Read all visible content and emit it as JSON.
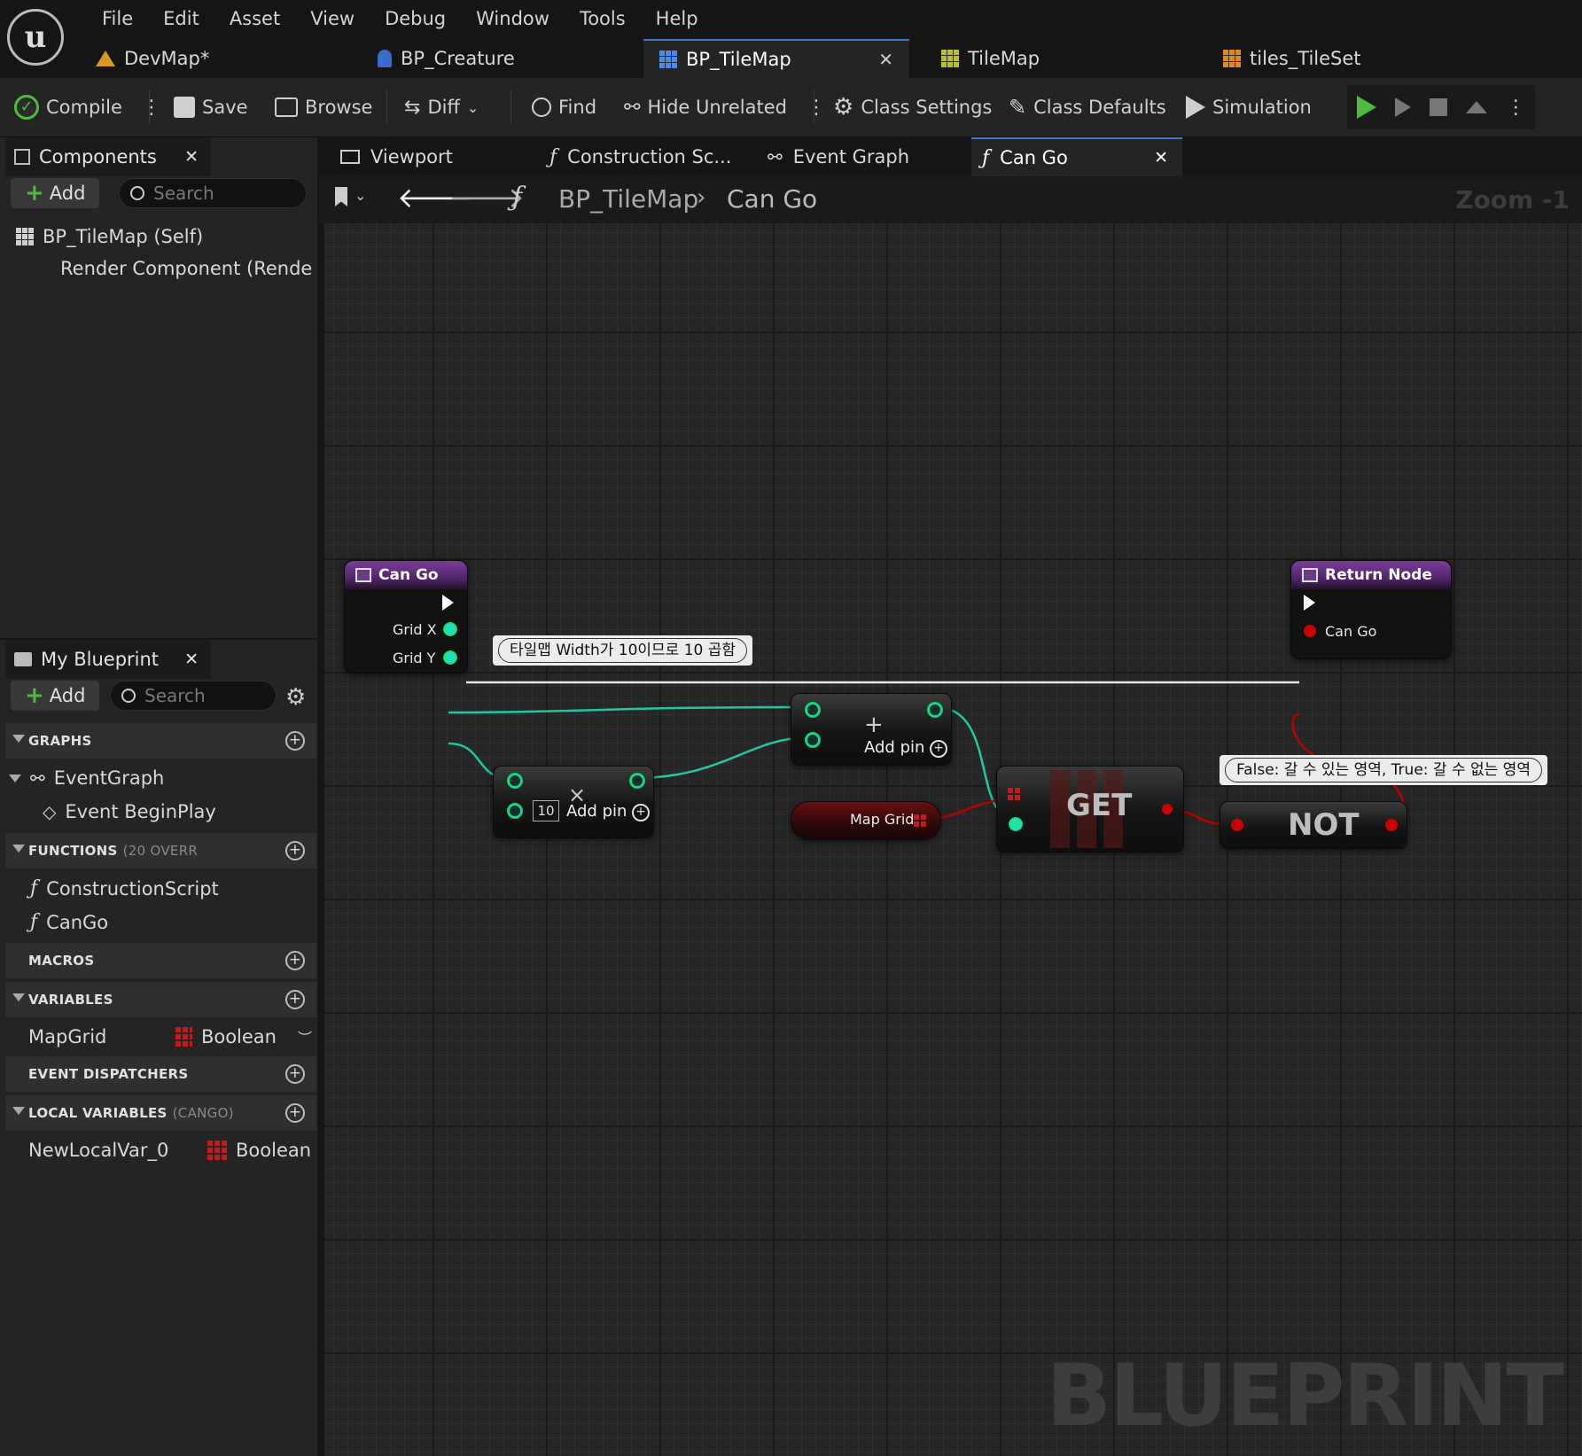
{
  "menu": [
    "File",
    "Edit",
    "Asset",
    "View",
    "Debug",
    "Window",
    "Tools",
    "Help"
  ],
  "asset_tabs": [
    {
      "label": "DevMap*",
      "icon": "map-icon"
    },
    {
      "label": "BP_Creature",
      "icon": "pawn-icon"
    },
    {
      "label": "BP_TileMap",
      "icon": "grid-icon",
      "active": true
    },
    {
      "label": "TileMap",
      "icon": "tilemap-icon"
    },
    {
      "label": "tiles_TileSet",
      "icon": "tileset-icon"
    }
  ],
  "toolbar": {
    "compile": "Compile",
    "save": "Save",
    "browse": "Browse",
    "diff": "Diff",
    "find": "Find",
    "hide_unrelated": "Hide Unrelated",
    "class_settings": "Class Settings",
    "class_defaults": "Class Defaults",
    "simulation": "Simulation"
  },
  "components": {
    "tab": "Components",
    "add": "Add",
    "search_placeholder": "Search",
    "items": [
      "BP_TileMap (Self)",
      "Render Component (RenderCo"
    ]
  },
  "my_blueprint": {
    "tab": "My Blueprint",
    "add": "Add",
    "search_placeholder": "Search",
    "graphs_header": "GRAPHS",
    "graphs": [
      "EventGraph",
      "Event BeginPlay"
    ],
    "functions_header": "FUNCTIONS",
    "functions_sub": "(20 OVERR",
    "functions": [
      "ConstructionScript",
      "CanGo"
    ],
    "macros_header": "MACROS",
    "variables_header": "VARIABLES",
    "variables": [
      {
        "name": "MapGrid",
        "type": "Boolean"
      }
    ],
    "dispatchers_header": "EVENT DISPATCHERS",
    "local_header": "LOCAL VARIABLES",
    "local_sub": "(CANGO)",
    "locals": [
      {
        "name": "NewLocalVar_0",
        "type": "Boolean"
      }
    ]
  },
  "doc_tabs": [
    "Viewport",
    "Construction Sc...",
    "Event Graph",
    "Can Go"
  ],
  "breadcrumb": {
    "root": "BP_TileMap",
    "current": "Can Go",
    "zoom": "Zoom -1"
  },
  "graph": {
    "entry_node": {
      "title": "Can Go",
      "pins": [
        "Grid X",
        "Grid Y"
      ]
    },
    "multiply_node": {
      "const": "10",
      "add_pin": "Add pin",
      "op": "×"
    },
    "add_node": {
      "add_pin": "Add pin",
      "op": "+"
    },
    "comment_multiply": "타일맵 Width가 10이므로 10 곱함",
    "map_grid_var": "Map Grid",
    "get_node": "GET",
    "not_node": "NOT",
    "comment_not": "False: 갈 수 있는 영역, True: 갈 수 없는 영역",
    "return_node": {
      "title": "Return Node",
      "pin": "Can Go"
    },
    "watermark": "BLUEPRINT"
  },
  "colors": {
    "accent": "#3a78d4",
    "compile_green": "#4cbc3c",
    "pin_float": "#20e0b0",
    "pin_bool": "#c00000",
    "function_header": "#7c3f9a"
  }
}
